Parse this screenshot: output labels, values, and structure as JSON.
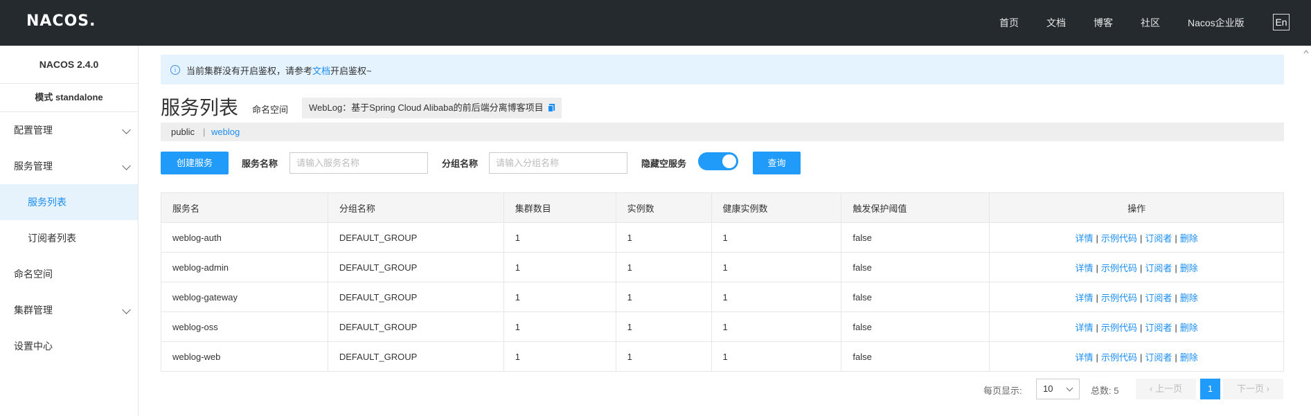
{
  "header": {
    "logo": "NACOS.",
    "nav": [
      "首页",
      "文档",
      "博客",
      "社区",
      "Nacos企业版"
    ],
    "lang": "En"
  },
  "sidebar": {
    "version": "NACOS 2.4.0",
    "mode": "模式 standalone",
    "items": [
      {
        "label": "配置管理",
        "expandable": true
      },
      {
        "label": "服务管理",
        "expandable": true
      },
      {
        "label": "服务列表",
        "active": true,
        "sub": true
      },
      {
        "label": "订阅者列表",
        "sub": true
      },
      {
        "label": "命名空间"
      },
      {
        "label": "集群管理",
        "expandable": true
      },
      {
        "label": "设置中心"
      }
    ]
  },
  "notice": {
    "prefix": "当前集群没有开启鉴权，请参考",
    "link": "文档",
    "suffix": "开启鉴权~"
  },
  "page": {
    "title": "服务列表",
    "namespace_label": "命名空间",
    "namespace_value": "WebLog：基于Spring Cloud Alibaba的前后端分离博客项目",
    "namespace_tabs": [
      "public",
      "weblog"
    ],
    "namespace_separator": "|"
  },
  "filters": {
    "create_button": "创建服务",
    "service_name_label": "服务名称",
    "service_name_placeholder": "请输入服务名称",
    "group_name_label": "分组名称",
    "group_name_placeholder": "请输入分组名称",
    "hide_empty_label": "隐藏空服务",
    "hide_empty_on": true,
    "query_button": "查询"
  },
  "table": {
    "headers": [
      "服务名",
      "分组名称",
      "集群数目",
      "实例数",
      "健康实例数",
      "触发保护阈值",
      "操作"
    ],
    "rows": [
      [
        "weblog-auth",
        "DEFAULT_GROUP",
        "1",
        "1",
        "1",
        "false"
      ],
      [
        "weblog-admin",
        "DEFAULT_GROUP",
        "1",
        "1",
        "1",
        "false"
      ],
      [
        "weblog-gateway",
        "DEFAULT_GROUP",
        "1",
        "1",
        "1",
        "false"
      ],
      [
        "weblog-oss",
        "DEFAULT_GROUP",
        "1",
        "1",
        "1",
        "false"
      ],
      [
        "weblog-web",
        "DEFAULT_GROUP",
        "1",
        "1",
        "1",
        "false"
      ]
    ],
    "actions": [
      "详情",
      "示例代码",
      "订阅者",
      "删除"
    ],
    "action_separator": "|"
  },
  "pagination": {
    "per_page_label": "每页显示:",
    "per_page_value": "10",
    "total_label": "总数:",
    "total": "5",
    "prev": "上一页",
    "next": "下一页",
    "current_page": "1"
  }
}
